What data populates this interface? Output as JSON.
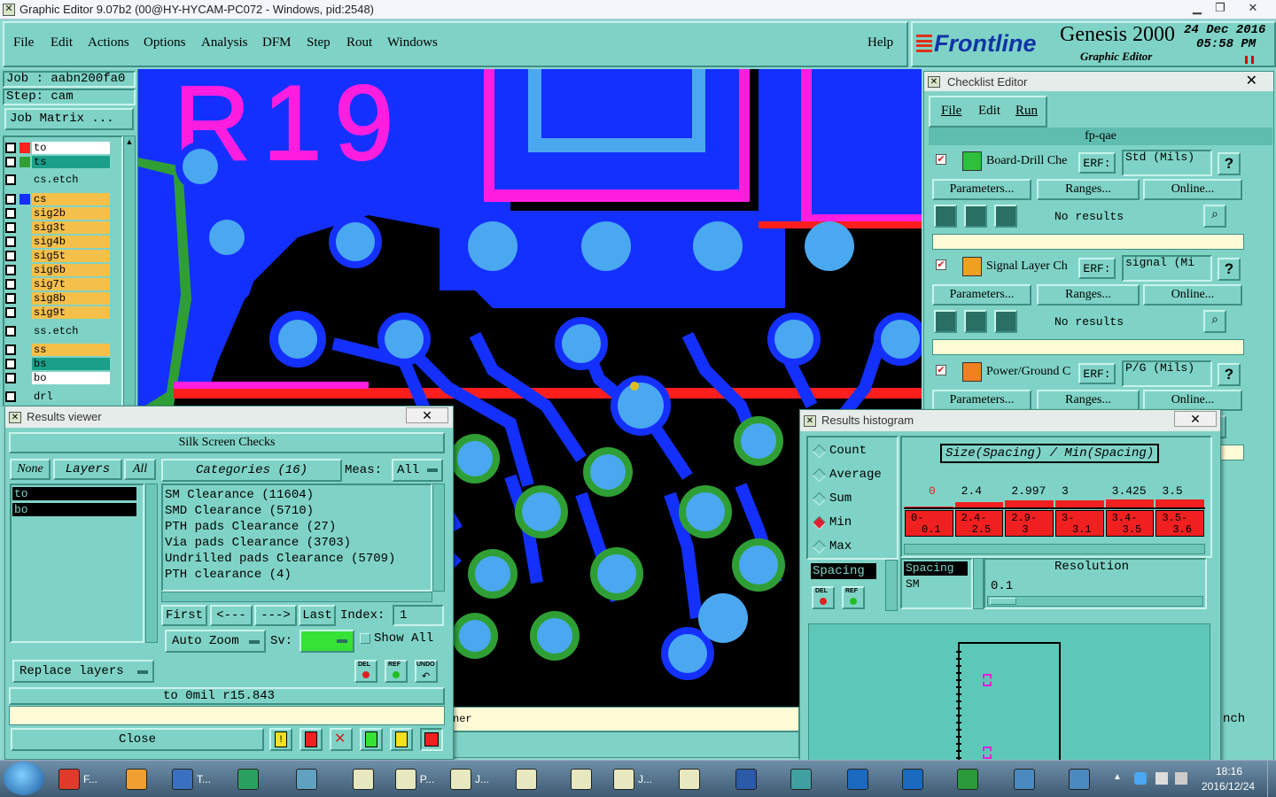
{
  "window": {
    "title": "Graphic Editor 9.07b2 (00@HY-HYCAM-PC072 - Windows, pid:2548)"
  },
  "menu": {
    "file": "File",
    "edit": "Edit",
    "actions": "Actions",
    "options": "Options",
    "analysis": "Analysis",
    "dfm": "DFM",
    "step": "Step",
    "rout": "Rout",
    "windows": "Windows",
    "help": "Help"
  },
  "brand": {
    "logo": "Frontline",
    "product": "Genesis 2000",
    "subtitle": "Graphic Editor",
    "date": "24 Dec 2016",
    "time": "05:58 PM"
  },
  "left": {
    "job": "Job : aabn200fa0",
    "step": "Step: cam",
    "job_matrix": "Job Matrix ...",
    "layers": [
      {
        "name": "to",
        "color": "#ff2020",
        "bg": "#ffffff"
      },
      {
        "name": "ts",
        "color": "#2f9f35",
        "bg": "#1aa08a"
      },
      {
        "name": "cs.etch",
        "color": null,
        "bg": "#7fd3c6"
      },
      {
        "name": "cs",
        "color": "#1430ff",
        "bg": "#f5c04a"
      },
      {
        "name": "sig2b",
        "color": null,
        "bg": "#f5c04a"
      },
      {
        "name": "sig3t",
        "color": null,
        "bg": "#f5c04a"
      },
      {
        "name": "sig4b",
        "color": null,
        "bg": "#f5c04a"
      },
      {
        "name": "sig5t",
        "color": null,
        "bg": "#f5c04a"
      },
      {
        "name": "sig6b",
        "color": null,
        "bg": "#f5c04a"
      },
      {
        "name": "sig7t",
        "color": null,
        "bg": "#f5c04a"
      },
      {
        "name": "sig8b",
        "color": null,
        "bg": "#f5c04a"
      },
      {
        "name": "sig9t",
        "color": null,
        "bg": "#f5c04a"
      },
      {
        "name": "ss.etch",
        "color": null,
        "bg": "#7fd3c6"
      },
      {
        "name": "ss",
        "color": null,
        "bg": "#f5c04a"
      },
      {
        "name": "bs",
        "color": null,
        "bg": "#1aa08a"
      },
      {
        "name": "bo",
        "color": null,
        "bg": "#ffffff"
      },
      {
        "name": "drl",
        "color": null,
        "bg": "#7fd3c6"
      }
    ]
  },
  "canvas": {
    "silk_text": "R19"
  },
  "checklist": {
    "title": "Checklist Editor",
    "menu": {
      "file": "File",
      "edit": "Edit",
      "run": "Run"
    },
    "name": "fp-qae",
    "items": [
      {
        "label": "Board-Drill Che",
        "erf_label": "ERF:",
        "erf_value": "Std (Mils)",
        "params": "Parameters...",
        "ranges": "Ranges...",
        "online": "Online...",
        "status": "No results"
      },
      {
        "label": "Signal Layer Ch",
        "erf_label": "ERF:",
        "erf_value": "signal (Mi",
        "params": "Parameters...",
        "ranges": "Ranges...",
        "online": "Online...",
        "status": "No results"
      },
      {
        "label": "Power/Ground C",
        "erf_label": "ERF:",
        "erf_value": "P/G (Mils)",
        "params": "Parameters...",
        "ranges": "Ranges...",
        "online": "Online...",
        "status": "No results"
      }
    ],
    "help": "?",
    "partial_text": "nch"
  },
  "results_viewer": {
    "title": "Results viewer",
    "header": "Silk Screen Checks",
    "none": "None",
    "layers": "Layers",
    "all": "All",
    "layer_list": [
      "to",
      "bo"
    ],
    "categories_btn": "Categories (16)",
    "meas_label": "Meas:",
    "meas_value": "All",
    "categories": [
      "SM Clearance (11604)",
      "SMD Clearance (5710)",
      "PTH pads Clearance (27)",
      "Via pads Clearance (3703)",
      "Undrilled pads Clearance (5709)",
      "PTH clearance (4)"
    ],
    "first": "First",
    "prev": "<---",
    "next": "--->",
    "last": "Last",
    "index_label": "Index:",
    "index_value": "1",
    "auto_zoom": "Auto Zoom",
    "sv_label": "Sv:",
    "show_all": "Show All",
    "replace_layers": "Replace layers",
    "status": "to  0mil  r15.843",
    "close": "Close",
    "del": "DEL",
    "ref": "REF",
    "undo": "UNDO"
  },
  "histogram": {
    "title": "Results histogram",
    "options": [
      "Count",
      "Average",
      "Sum",
      "Min",
      "Max"
    ],
    "selected": "Min",
    "spacing_label": "Spacing",
    "formula": "Size(Spacing) / Min(Spacing)",
    "bins": [
      {
        "value": "0",
        "range_top": "0-",
        "range_bot": "0.1"
      },
      {
        "value": "2.4",
        "range_top": "2.4-",
        "range_bot": "2.5"
      },
      {
        "value": "2.997",
        "range_top": "2.9-",
        "range_bot": "3"
      },
      {
        "value": "3",
        "range_top": "3-",
        "range_bot": "3.1"
      },
      {
        "value": "3.425",
        "range_top": "3.4-",
        "range_bot": "3.5"
      },
      {
        "value": "3.5",
        "range_top": "3.5-",
        "range_bot": "3.6"
      }
    ],
    "list": [
      "Spacing",
      "SM"
    ],
    "resolution_label": "Resolution",
    "resolution_value": "0.1",
    "del": "DEL",
    "ref": "REF"
  },
  "statusbar": {
    "partial": "ner"
  },
  "taskbar": {
    "labels": [
      "F...",
      "T...",
      "P...",
      "J...",
      "J..."
    ],
    "time": "18:16",
    "date": "2016/12/24"
  }
}
